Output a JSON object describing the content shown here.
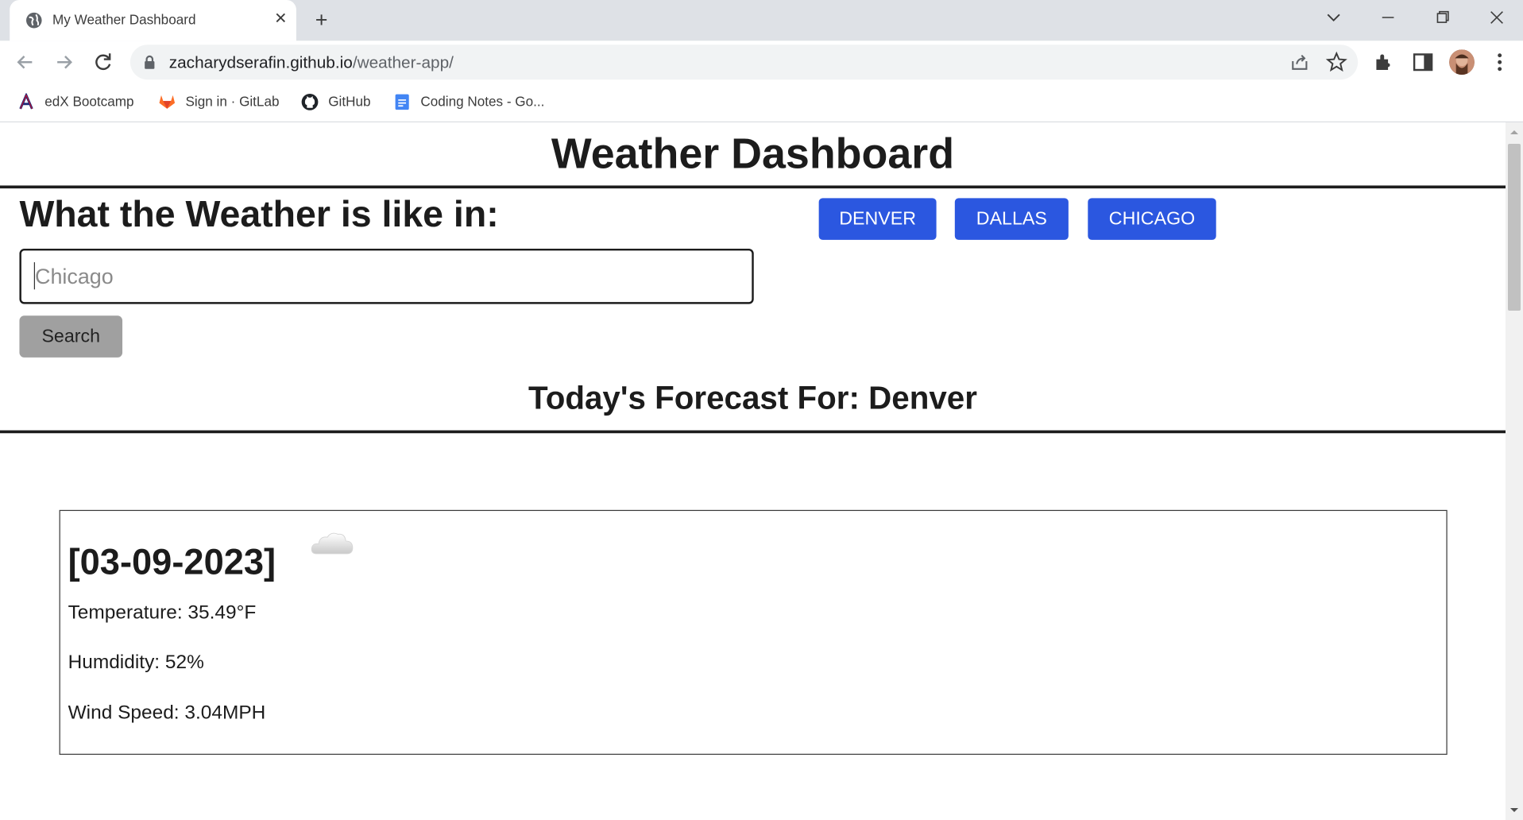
{
  "browser": {
    "tab_title": "My Weather Dashboard",
    "tab_close": "✕",
    "new_tab": "+",
    "url_host": "zacharydserafin.github.io",
    "url_path": "/weather-app/",
    "bookmarks": [
      {
        "label": "edX Bootcamp",
        "icon": "arizona-logo-icon"
      },
      {
        "label": "Sign in · GitLab",
        "icon": "gitlab-icon"
      },
      {
        "label": "GitHub",
        "icon": "github-icon"
      },
      {
        "label": "Coding Notes - Go...",
        "icon": "google-docs-icon"
      }
    ]
  },
  "page": {
    "title": "Weather Dashboard",
    "subheading": "What the Weather is like in:",
    "search": {
      "placeholder": "Chicago",
      "value": "",
      "button_label": "Search"
    },
    "city_buttons": [
      {
        "label": "DENVER"
      },
      {
        "label": "DALLAS"
      },
      {
        "label": "CHICAGO"
      }
    ],
    "accent_color": "#2b57e0",
    "forecast_title": "Today's Forecast For: Denver",
    "today": {
      "date": "[03-09-2023]",
      "icon": "cloud-icon",
      "temperature": "Temperature: 35.49°F",
      "humidity": "Humdidity: 52%",
      "wind": "Wind Speed: 3.04MPH"
    }
  }
}
